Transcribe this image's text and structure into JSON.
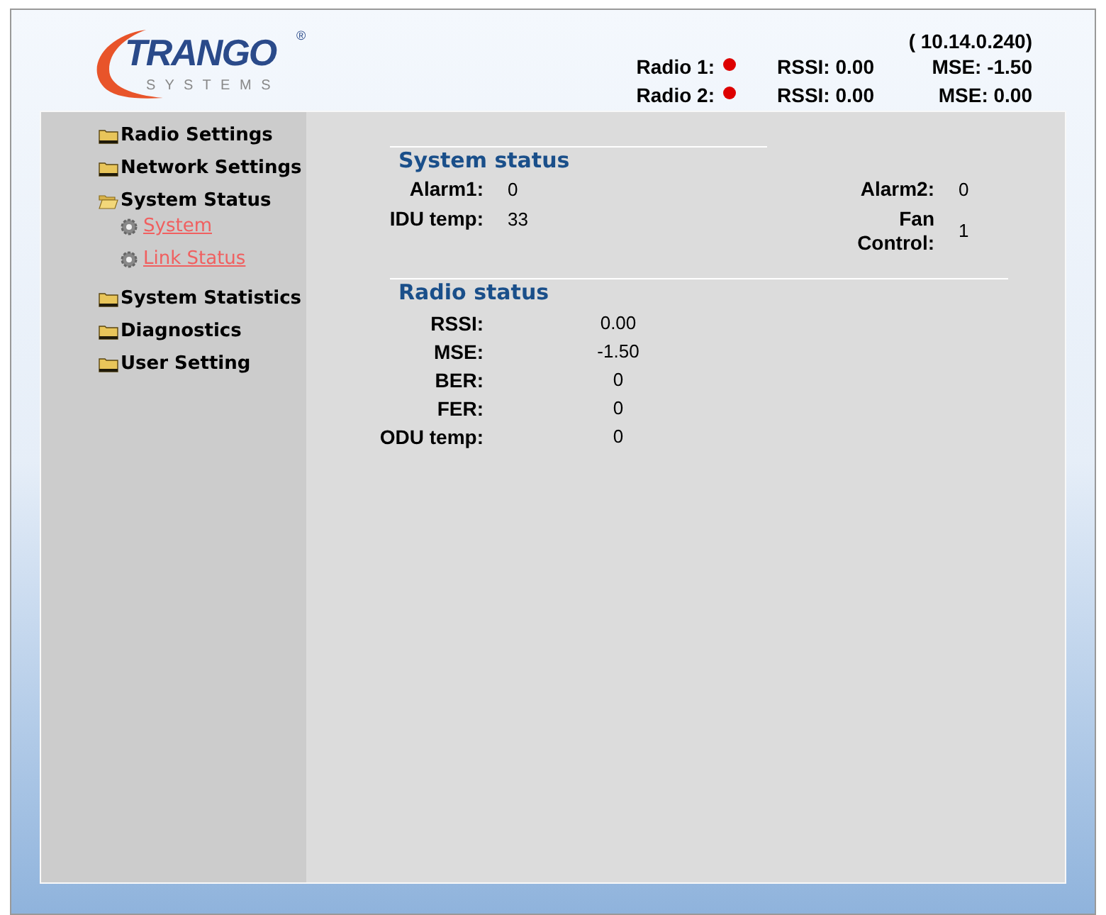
{
  "logo": {
    "brand": "TRANGO",
    "mark": "®",
    "tagline": "S Y S T E M S"
  },
  "header": {
    "ip": "( 10.14.0.240)",
    "radios": [
      {
        "label": "Radio 1:",
        "color": "#dd0000",
        "rssi": "RSSI: 0.00",
        "mse": "MSE: -1.50"
      },
      {
        "label": "Radio 2:",
        "color": "#dd0000",
        "rssi": "RSSI: 0.00",
        "mse": "MSE: 0.00"
      }
    ]
  },
  "sidebar": {
    "items": [
      {
        "kind": "folder",
        "label": "Radio Settings",
        "expanded": false
      },
      {
        "kind": "folder",
        "label": "Network Settings",
        "expanded": false
      },
      {
        "kind": "folder",
        "label": "System Status",
        "expanded": true,
        "children": [
          {
            "kind": "page",
            "label": "System"
          },
          {
            "kind": "page",
            "label": "Link Status"
          }
        ]
      },
      {
        "kind": "folder",
        "label": "System Statistics",
        "expanded": false
      },
      {
        "kind": "folder",
        "label": "Diagnostics",
        "expanded": false
      },
      {
        "kind": "folder",
        "label": "User Setting",
        "expanded": false
      }
    ]
  },
  "system_status": {
    "title": "System status",
    "fields": [
      {
        "label": "Alarm1:",
        "value": "0"
      },
      {
        "label": "Alarm2:",
        "value": "0"
      },
      {
        "label": "IDU temp:",
        "value": "33"
      },
      {
        "label": "Fan Control:",
        "value": "1"
      }
    ]
  },
  "radio_status": {
    "title": "Radio status",
    "fields": [
      {
        "label": "RSSI:",
        "value": "0.00"
      },
      {
        "label": "MSE:",
        "value": "-1.50"
      },
      {
        "label": "BER:",
        "value": "0"
      },
      {
        "label": "FER:",
        "value": "0"
      },
      {
        "label": "ODU temp:",
        "value": "0"
      }
    ]
  }
}
